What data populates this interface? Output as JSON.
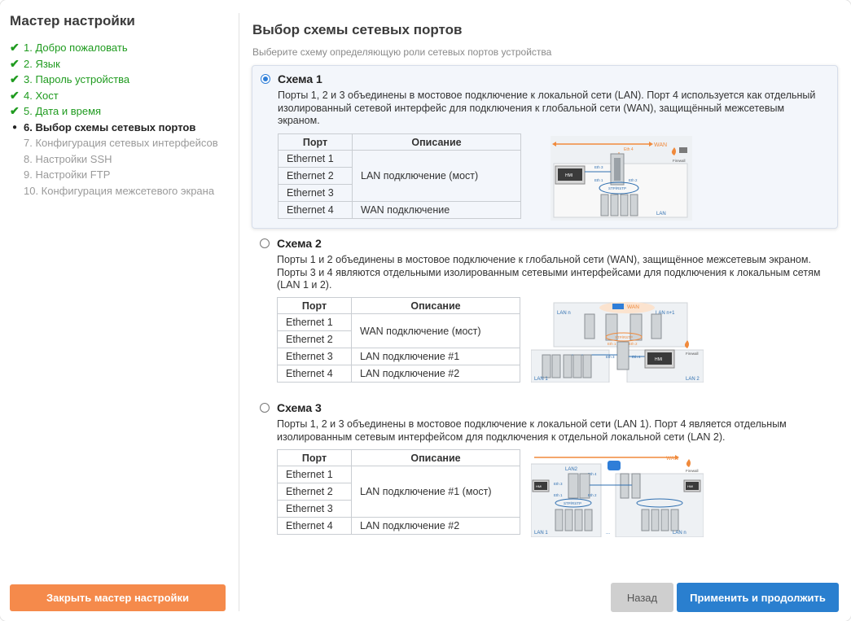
{
  "sidebar": {
    "title": "Мастер настройки",
    "steps": [
      {
        "label": "1. Добро пожаловать",
        "state": "done"
      },
      {
        "label": "2. Язык",
        "state": "done"
      },
      {
        "label": "3. Пароль устройства",
        "state": "done"
      },
      {
        "label": "4. Хост",
        "state": "done"
      },
      {
        "label": "5. Дата и время",
        "state": "done"
      },
      {
        "label": "6. Выбор схемы сетевых портов",
        "state": "current"
      },
      {
        "label": "7. Конфигурация сетевых интерфейсов",
        "state": "pending"
      },
      {
        "label": "8. Настройки SSH",
        "state": "pending"
      },
      {
        "label": "9. Настройки FTP",
        "state": "pending"
      },
      {
        "label": "10. Конфигурация межсетевого экрана",
        "state": "pending"
      }
    ],
    "check_mark": "✔",
    "bullet_mark": "●",
    "close_label": "Закрыть мастер настройки"
  },
  "main": {
    "title": "Выбор схемы сетевых портов",
    "subtitle": "Выберите схему определяющую роли сетевых портов устройства",
    "table_headers": {
      "port": "Порт",
      "description": "Описание"
    },
    "schemes": [
      {
        "name": "Схема 1",
        "selected": true,
        "description": "Порты 1, 2 и 3 объединены в мостовое подключение к локальной сети (LAN). Порт 4 используется как отдельный изолированный сетевой интерфейс для подключения к глобальной сети (WAN), защищённый межсетевым экраном.",
        "ports": [
          "Ethernet 1",
          "Ethernet 2",
          "Ethernet 3",
          "Ethernet 4"
        ],
        "descriptions": [
          "LAN подключение (мост)",
          "WAN подключение"
        ],
        "diagram": {
          "wan": "WAN",
          "eth4": "Eth 4",
          "firewall": "Firewall",
          "hmi": "HMI",
          "eth1": "Eth 1",
          "eth2": "Eth 2",
          "eth3": "Eth 3",
          "stp": "STP/RSTP",
          "lan": "LAN"
        }
      },
      {
        "name": "Схема 2",
        "selected": false,
        "description": "Порты 1 и 2 объединены в мостовое подключение к глобальной сети (WAN), защищённое межсетевым экраном. Порты 3 и 4 являются отдельными изолированным сетевыми интерфейсами для подключения к локальным сетям (LAN 1 и 2).",
        "ports": [
          "Ethernet 1",
          "Ethernet 2",
          "Ethernet 3",
          "Ethernet 4"
        ],
        "descriptions": [
          "WAN подключение (мост)",
          "LAN подключение #1",
          "LAN подключение #2"
        ],
        "diagram": {
          "wan": "WAN",
          "lan_n": "LAN n",
          "lan_n1": "LAN n+1",
          "stp": "STP/RSTP",
          "eth1": "Eth 1",
          "eth2": "Eth 2",
          "eth3": "Eth 3",
          "eth4": "Eth 4",
          "hmi": "HMI",
          "firewall": "Firewall",
          "lan1": "LAN 1",
          "lan2": "LAN 2"
        }
      },
      {
        "name": "Схема 3",
        "selected": false,
        "description": "Порты 1, 2 и 3 объединены в мостовое подключение к локальной сети (LAN 1). Порт 4 является отдельным изолированным сетевым интерфейсом для подключения к отдельной локальной сети (LAN 2).",
        "ports": [
          "Ethernet 1",
          "Ethernet 2",
          "Ethernet 3",
          "Ethernet 4"
        ],
        "descriptions": [
          "LAN подключение #1 (мост)",
          "LAN подключение #2"
        ],
        "diagram": {
          "wan": "WAN",
          "firewall": "Firewall",
          "lan2": "LAN2",
          "eth3": "Eth 3",
          "eth4": "Eth 4",
          "eth1": "Eth 1",
          "eth2": "Eth 2",
          "stp": "STP/RSTP",
          "hmi": "HMI",
          "lan1": "LAN 1",
          "dots": "...",
          "lan_n": "LAN n"
        }
      }
    ]
  },
  "footer": {
    "back_label": "Назад",
    "apply_label": "Применить и продолжить"
  },
  "colors": {
    "done": "#1f9b1f",
    "accent": "#2a7fcf",
    "close": "#f58a4b",
    "wan": "#f08a3c",
    "lan_line": "#2f6fb0"
  }
}
